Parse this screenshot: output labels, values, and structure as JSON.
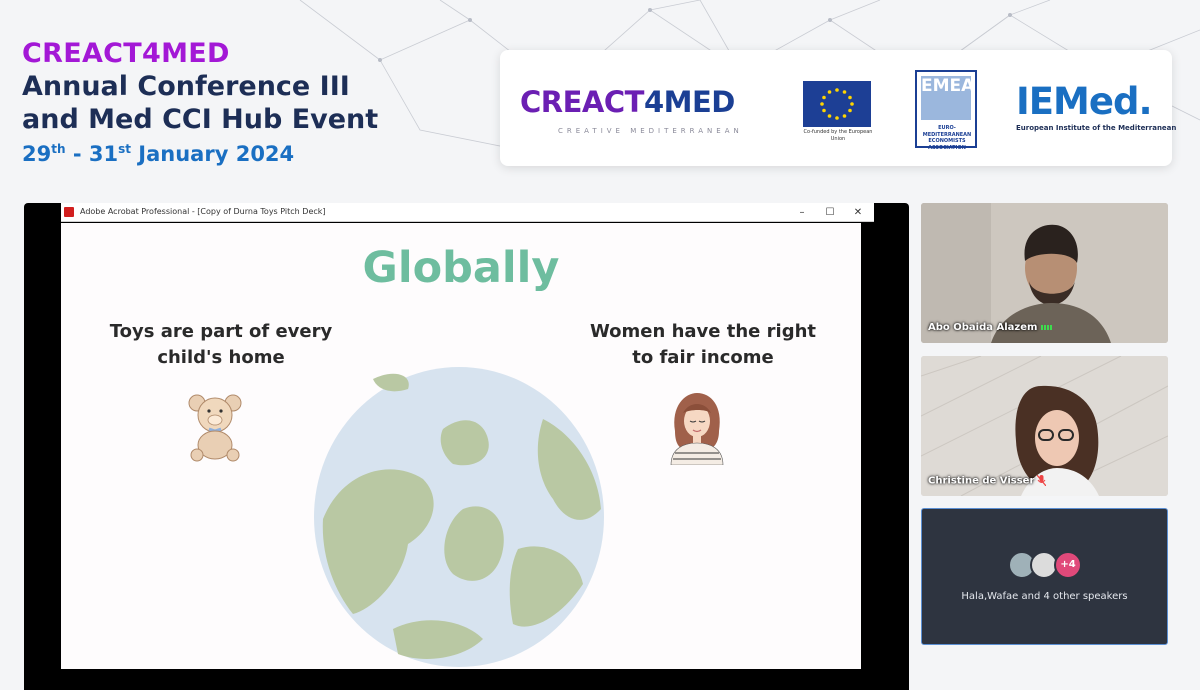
{
  "conference": {
    "brand": "CREACT4MED",
    "line1": "Annual Conference III",
    "line2": "and Med CCI Hub Event",
    "date_start": "29",
    "date_start_suffix": "th",
    "date_sep": " - ",
    "date_end": "31",
    "date_end_suffix": "st",
    "date_rest": " January 2024"
  },
  "logos": {
    "creact_part1": "CREACT",
    "creact_part2": "4MED",
    "creact_sub": "CREATIVE MEDITERRANEAN",
    "eu_text": "Co-funded by the European Union",
    "emea_letters": "EMEA",
    "emea_caption": "EURO-MEDITERRANEAN ECONOMISTS ASSOCIATION",
    "iemed": "IEMed.",
    "iemed_sub": "European Institute of the Mediterranean"
  },
  "share": {
    "window_title": "Adobe Acrobat Professional - [Copy of Durna Toys Pitch Deck]",
    "minimize": "–",
    "maximize": "☐",
    "close": "✕",
    "slide": {
      "title": "Globally",
      "left_text": "Toys are part of every child's home",
      "right_text": "Women have the right to fair income"
    }
  },
  "participants": [
    {
      "name": "Abo Obaida Alazem",
      "status_icon": "signal-icon"
    },
    {
      "name": "Christine de Visser",
      "status_icon": "mic-off-icon"
    }
  ],
  "speakers": {
    "extra_count": "+4",
    "text": "Hala,Wafae and 4 other speakers"
  },
  "colors": {
    "brand_purple": "#a318d6",
    "title_navy": "#1d2e56",
    "date_blue": "#1a6fc2",
    "slide_title_green": "#6ebd9f"
  }
}
